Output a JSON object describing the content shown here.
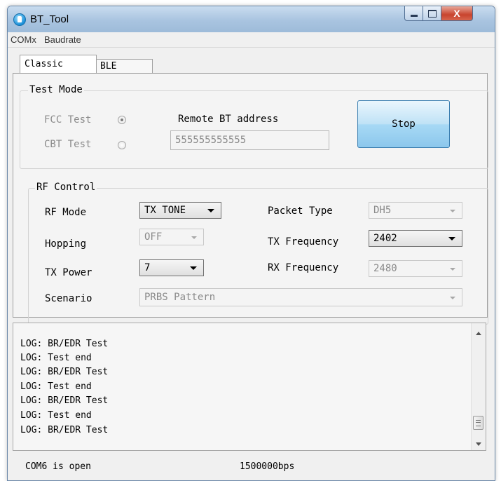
{
  "window": {
    "title": "BT_Tool",
    "close_glyph": "X"
  },
  "menu": {
    "items": [
      "COMx",
      "Baudrate"
    ]
  },
  "tabs": [
    {
      "label": "Classic",
      "active": true
    },
    {
      "label": "BLE",
      "active": false
    }
  ],
  "test_mode": {
    "group_label": "Test Mode",
    "fcc_label": "FCC Test",
    "fcc_checked": true,
    "cbt_label": "CBT Test",
    "cbt_checked": false,
    "remote_label": "Remote BT address",
    "remote_value": "555555555555",
    "stop_label": "Stop"
  },
  "rf_control": {
    "group_label": "RF Control",
    "rf_mode_label": "RF Mode",
    "rf_mode_value": "TX TONE",
    "packet_type_label": "Packet Type",
    "packet_type_value": "DH5",
    "hopping_label": "Hopping",
    "hopping_value": "OFF",
    "tx_freq_label": "TX Frequency",
    "tx_freq_value": "2402",
    "tx_power_label": "TX Power",
    "tx_power_value": "7",
    "rx_freq_label": "RX Frequency",
    "rx_freq_value": "2480",
    "scenario_label": "Scenario",
    "scenario_value": "PRBS Pattern"
  },
  "log": {
    "lines": [
      "LOG: BR/EDR Test",
      "LOG: Test end",
      "LOG: BR/EDR Test",
      "LOG: Test end",
      "LOG: BR/EDR Test",
      "LOG: Test end",
      "LOG: BR/EDR Test"
    ]
  },
  "status": {
    "port": "COM6 is open",
    "baud": "1500000bps"
  },
  "icons": {
    "app": "app-icon",
    "minimize": "minimize-icon",
    "maximize": "maximize-icon",
    "close": "close-icon"
  },
  "colors": {
    "titlebar": "#a9c4e0",
    "close_button": "#c8442e",
    "stop_button": "#a7d9f5",
    "window_bg": "#f0f0f0"
  }
}
